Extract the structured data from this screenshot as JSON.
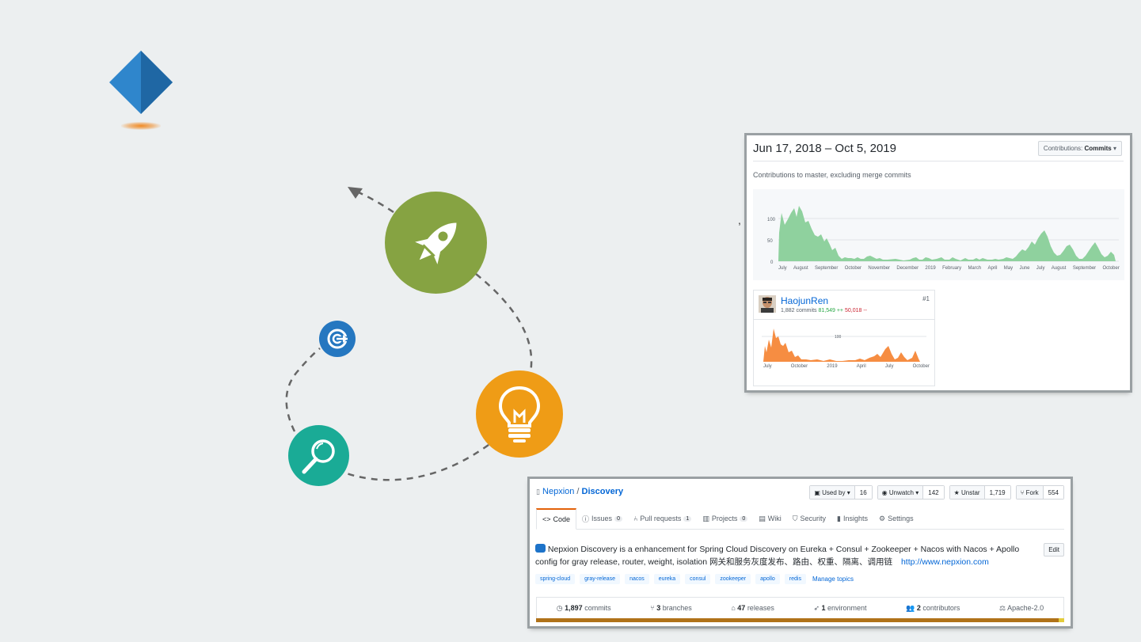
{
  "stats": {
    "date_range": "Jun 17, 2018 – Oct 5, 2019",
    "contributions_label": "Contributions:",
    "contributions_value": "Commits",
    "note": "Contributions to master, excluding merge commits",
    "y_ticks": [
      "100",
      "50",
      "0"
    ],
    "x_ticks": [
      "July",
      "August",
      "September",
      "October",
      "November",
      "December",
      "2019",
      "February",
      "March",
      "April",
      "May",
      "June",
      "July",
      "August",
      "September",
      "October"
    ],
    "comma": ","
  },
  "contributor": {
    "name": "HaojunRen",
    "rank": "#1",
    "commits": "1,882 commits",
    "additions": "81,549 ++",
    "deletions": "50,018 --",
    "y_tick": "100",
    "x_ticks": [
      "July",
      "October",
      "2019",
      "April",
      "July",
      "October"
    ]
  },
  "repo": {
    "owner": "Nepxion",
    "slash": " / ",
    "name": "Discovery",
    "used_by_label": "Used by",
    "used_by_count": "16",
    "watch_label": "Unwatch",
    "watch_count": "142",
    "star_label": "Unstar",
    "star_count": "1,719",
    "fork_label": "Fork",
    "fork_count": "554",
    "tabs": [
      {
        "label": "Code",
        "icon": "<>"
      },
      {
        "label": "Issues",
        "count": "0"
      },
      {
        "label": "Pull requests",
        "count": "1"
      },
      {
        "label": "Projects",
        "count": "0"
      },
      {
        "label": "Wiki"
      },
      {
        "label": "Security"
      },
      {
        "label": "Insights"
      },
      {
        "label": "Settings"
      }
    ],
    "description": "Nepxion Discovery is a enhancement for Spring Cloud Discovery on Eureka + Consul + Zookeeper + Nacos with Nacos + Apollo config for gray release, router, weight, isolation 网关和服务灰度发布、路由、权重、隔离、调用链",
    "url": "http://www.nepxion.com",
    "edit_label": "Edit",
    "topics": [
      "spring-cloud",
      "gray-release",
      "nacos",
      "eureka",
      "consul",
      "zookeeper",
      "apollo",
      "redis"
    ],
    "manage_topics": "Manage topics",
    "summary": [
      {
        "num": "1,897",
        "label": "commits"
      },
      {
        "num": "3",
        "label": "branches"
      },
      {
        "num": "47",
        "label": "releases"
      },
      {
        "num": "1",
        "label": "environment"
      },
      {
        "num": "2",
        "label": "contributors"
      },
      {
        "num": "",
        "label": "Apache-2.0"
      }
    ]
  },
  "colors": {
    "rocket_circle": "#86a342",
    "bulb_circle": "#ef9c16",
    "search_circle": "#1aab96",
    "target_circle": "#2577c0",
    "diamond_light": "#2f86cc",
    "diamond_dark": "#1f67a4",
    "commit_area": "#8fd19e",
    "contributor_area": "#f68d42",
    "lang_bar_main": "#b07219"
  }
}
